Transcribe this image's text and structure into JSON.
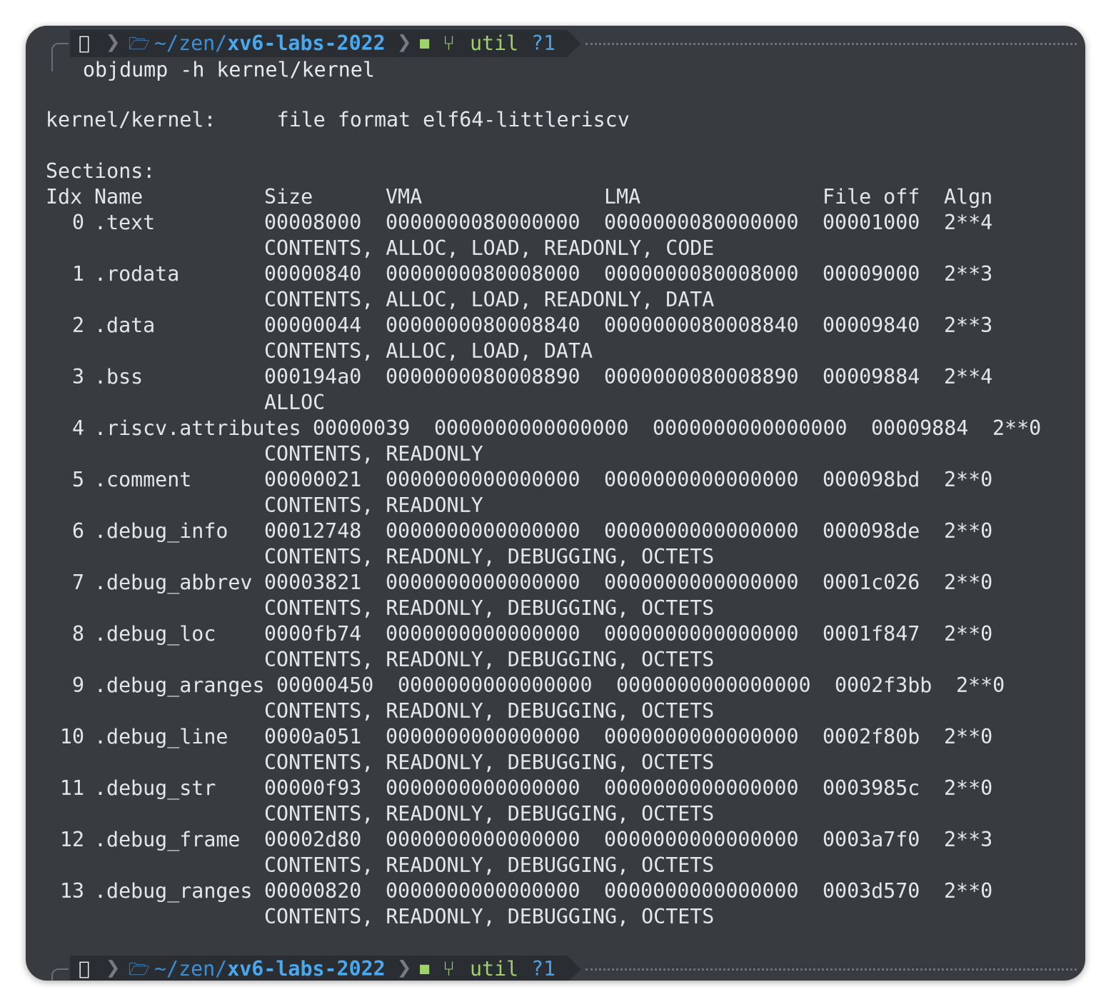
{
  "prompt": {
    "apple_icon": "apple-icon",
    "folder_icon": "folder-icon",
    "path_home": "~/",
    "path_dir": "zen/",
    "path_repo": "xv6-labs-2022",
    "github_icon": "github-icon",
    "branch_icon": "git-branch-icon",
    "branch": "util",
    "git_status": "?1",
    "colors": {
      "path": "#3b8fd6",
      "repo": "#48a8f0",
      "branch": "#9ed36a",
      "background": "#383b40"
    }
  },
  "command": "objdump -h kernel/kernel",
  "output": {
    "file_line": "kernel/kernel:     file format elf64-littleriscv",
    "sections_label": "Sections:",
    "headers": [
      "Idx",
      "Name",
      "Size",
      "VMA",
      "LMA",
      "File off",
      "Algn"
    ],
    "sections": [
      {
        "idx": "0",
        "name": ".text",
        "size": "00008000",
        "vma": "0000000080000000",
        "lma": "0000000080000000",
        "file_off": "00001000",
        "algn": "2**4",
        "flags": "CONTENTS, ALLOC, LOAD, READONLY, CODE"
      },
      {
        "idx": "1",
        "name": ".rodata",
        "size": "00000840",
        "vma": "0000000080008000",
        "lma": "0000000080008000",
        "file_off": "00009000",
        "algn": "2**3",
        "flags": "CONTENTS, ALLOC, LOAD, READONLY, DATA"
      },
      {
        "idx": "2",
        "name": ".data",
        "size": "00000044",
        "vma": "0000000080008840",
        "lma": "0000000080008840",
        "file_off": "00009840",
        "algn": "2**3",
        "flags": "CONTENTS, ALLOC, LOAD, DATA"
      },
      {
        "idx": "3",
        "name": ".bss",
        "size": "000194a0",
        "vma": "0000000080008890",
        "lma": "0000000080008890",
        "file_off": "00009884",
        "algn": "2**4",
        "flags": "ALLOC"
      },
      {
        "idx": "4",
        "name": ".riscv.attributes",
        "size": "00000039",
        "vma": "0000000000000000",
        "lma": "0000000000000000",
        "file_off": "00009884",
        "algn": "2**0",
        "flags": "CONTENTS, READONLY"
      },
      {
        "idx": "5",
        "name": ".comment",
        "size": "00000021",
        "vma": "0000000000000000",
        "lma": "0000000000000000",
        "file_off": "000098bd",
        "algn": "2**0",
        "flags": "CONTENTS, READONLY"
      },
      {
        "idx": "6",
        "name": ".debug_info",
        "size": "00012748",
        "vma": "0000000000000000",
        "lma": "0000000000000000",
        "file_off": "000098de",
        "algn": "2**0",
        "flags": "CONTENTS, READONLY, DEBUGGING, OCTETS"
      },
      {
        "idx": "7",
        "name": ".debug_abbrev",
        "size": "00003821",
        "vma": "0000000000000000",
        "lma": "0000000000000000",
        "file_off": "0001c026",
        "algn": "2**0",
        "flags": "CONTENTS, READONLY, DEBUGGING, OCTETS"
      },
      {
        "idx": "8",
        "name": ".debug_loc",
        "size": "0000fb74",
        "vma": "0000000000000000",
        "lma": "0000000000000000",
        "file_off": "0001f847",
        "algn": "2**0",
        "flags": "CONTENTS, READONLY, DEBUGGING, OCTETS"
      },
      {
        "idx": "9",
        "name": ".debug_aranges",
        "size": "00000450",
        "vma": "0000000000000000",
        "lma": "0000000000000000",
        "file_off": "0002f3bb",
        "algn": "2**0",
        "flags": "CONTENTS, READONLY, DEBUGGING, OCTETS"
      },
      {
        "idx": "10",
        "name": ".debug_line",
        "size": "0000a051",
        "vma": "0000000000000000",
        "lma": "0000000000000000",
        "file_off": "0002f80b",
        "algn": "2**0",
        "flags": "CONTENTS, READONLY, DEBUGGING, OCTETS"
      },
      {
        "idx": "11",
        "name": ".debug_str",
        "size": "00000f93",
        "vma": "0000000000000000",
        "lma": "0000000000000000",
        "file_off": "0003985c",
        "algn": "2**0",
        "flags": "CONTENTS, READONLY, DEBUGGING, OCTETS"
      },
      {
        "idx": "12",
        "name": ".debug_frame",
        "size": "00002d80",
        "vma": "0000000000000000",
        "lma": "0000000000000000",
        "file_off": "0003a7f0",
        "algn": "2**3",
        "flags": "CONTENTS, READONLY, DEBUGGING, OCTETS"
      },
      {
        "idx": "13",
        "name": ".debug_ranges",
        "size": "00000820",
        "vma": "0000000000000000",
        "lma": "0000000000000000",
        "file_off": "0003d570",
        "algn": "2**0",
        "flags": "CONTENTS, READONLY, DEBUGGING, OCTETS"
      }
    ]
  }
}
